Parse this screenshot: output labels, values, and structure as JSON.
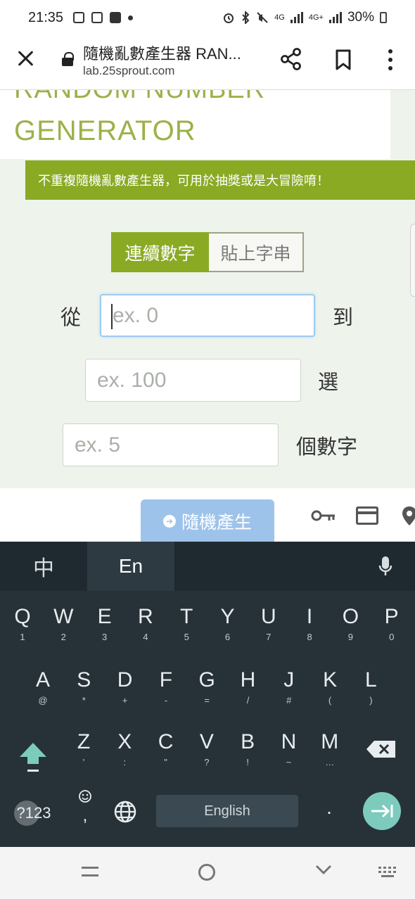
{
  "status_bar": {
    "time": "21:35",
    "network_1": "4G",
    "network_2": "4G+",
    "battery": "30%"
  },
  "browser": {
    "title": "隨機亂數產生器 RAN...",
    "url": "lab.25sprout.com"
  },
  "page": {
    "hero_cut_text": "RANDOM NUMBER",
    "hero_title": "GENERATOR",
    "banner": "不重複隨機亂數產生器，可用於抽獎或是大冒險唷！",
    "tabs": [
      {
        "label": "連續數字",
        "active": true
      },
      {
        "label": "貼上字串",
        "active": false
      }
    ],
    "label_from": "從",
    "label_to": "到",
    "label_pick": "選",
    "label_count": "個數字",
    "from_input": {
      "value": "",
      "placeholder": "ex. 0"
    },
    "to_input": {
      "value": "",
      "placeholder": "ex. 100"
    },
    "count_input": {
      "value": "",
      "placeholder": "ex. 5"
    },
    "generate_button": "隨機產生"
  },
  "keyboard": {
    "lang_zh": "中",
    "lang_en": "En",
    "row1": [
      {
        "k": "Q",
        "s": "1"
      },
      {
        "k": "W",
        "s": "2"
      },
      {
        "k": "E",
        "s": "3"
      },
      {
        "k": "R",
        "s": "4"
      },
      {
        "k": "T",
        "s": "5"
      },
      {
        "k": "Y",
        "s": "6"
      },
      {
        "k": "U",
        "s": "7"
      },
      {
        "k": "I",
        "s": "8"
      },
      {
        "k": "O",
        "s": "9"
      },
      {
        "k": "P",
        "s": "0"
      }
    ],
    "row2": [
      {
        "k": "A",
        "s": "@"
      },
      {
        "k": "S",
        "s": "*"
      },
      {
        "k": "D",
        "s": "+"
      },
      {
        "k": "F",
        "s": "-"
      },
      {
        "k": "G",
        "s": "="
      },
      {
        "k": "H",
        "s": "/"
      },
      {
        "k": "J",
        "s": "#"
      },
      {
        "k": "K",
        "s": "("
      },
      {
        "k": "L",
        "s": ")"
      }
    ],
    "row3": [
      {
        "k": "Z",
        "s": "'"
      },
      {
        "k": "X",
        "s": ":"
      },
      {
        "k": "C",
        "s": "\""
      },
      {
        "k": "V",
        "s": "?"
      },
      {
        "k": "B",
        "s": "!"
      },
      {
        "k": "N",
        "s": "~"
      },
      {
        "k": "M",
        "s": "…"
      }
    ],
    "symbols_key": "?123",
    "comma": ",",
    "space_label": "English",
    "period": "."
  },
  "icons": {
    "status_left": [
      "screenshot-icon",
      "screenshot-icon",
      "gallery-icon",
      "dot-icon"
    ],
    "status_right": [
      "alarm-icon",
      "bluetooth-icon",
      "mute-icon",
      "signal-icon",
      "signal-icon",
      "battery-icon"
    ]
  },
  "colors": {
    "accent_green": "#8aaa24",
    "title_green": "#9bb14a",
    "button_blue": "#9dc3ea",
    "keyboard_bg": "#263238",
    "enter_teal": "#7dcbbd"
  }
}
